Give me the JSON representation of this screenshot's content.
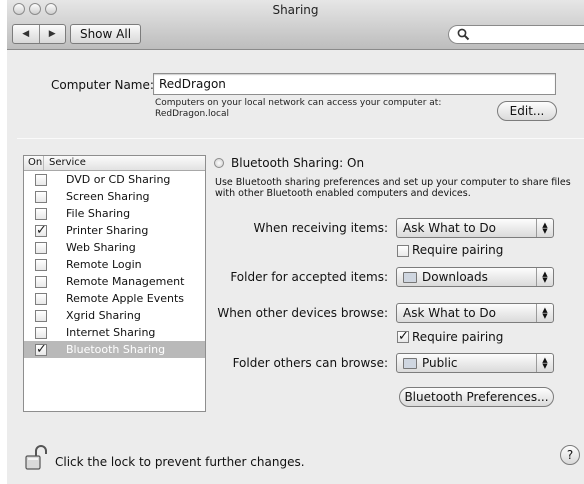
{
  "window": {
    "title": "Sharing"
  },
  "toolbar": {
    "back_icon": "◀",
    "forward_icon": "▶",
    "show_all_label": "Show All",
    "search_placeholder": ""
  },
  "computer_name": {
    "label": "Computer Name:",
    "value": "RedDragon",
    "description_line1": "Computers on your local network can access your computer at:",
    "description_line2": "RedDragon.local",
    "edit_label": "Edit..."
  },
  "services": {
    "header_on": "On",
    "header_service": "Service",
    "items": [
      {
        "name": "DVD or CD Sharing",
        "checked": false,
        "selected": false
      },
      {
        "name": "Screen Sharing",
        "checked": false,
        "selected": false
      },
      {
        "name": "File Sharing",
        "checked": false,
        "selected": false
      },
      {
        "name": "Printer Sharing",
        "checked": true,
        "selected": false
      },
      {
        "name": "Web Sharing",
        "checked": false,
        "selected": false
      },
      {
        "name": "Remote Login",
        "checked": false,
        "selected": false
      },
      {
        "name": "Remote Management",
        "checked": false,
        "selected": false
      },
      {
        "name": "Remote Apple Events",
        "checked": false,
        "selected": false
      },
      {
        "name": "Xgrid Sharing",
        "checked": false,
        "selected": false
      },
      {
        "name": "Internet Sharing",
        "checked": false,
        "selected": false
      },
      {
        "name": "Bluetooth Sharing",
        "checked": true,
        "selected": true
      }
    ]
  },
  "detail": {
    "status": "Bluetooth Sharing: On",
    "description_line1": "Use Bluetooth sharing preferences and set up your computer to share files",
    "description_line2": "with other Bluetooth enabled computers and devices.",
    "receiving_label": "When receiving items:",
    "receiving_value": "Ask What to Do",
    "require_pairing_1_label": "Require pairing",
    "require_pairing_1_checked": false,
    "accepted_folder_label": "Folder for accepted items:",
    "accepted_folder_value": "Downloads",
    "browse_label": "When other devices browse:",
    "browse_value": "Ask What to Do",
    "require_pairing_2_label": "Require pairing",
    "require_pairing_2_checked": true,
    "browse_folder_label": "Folder others can browse:",
    "browse_folder_value": "Public",
    "bt_prefs_label": "Bluetooth Preferences..."
  },
  "footer": {
    "lock_text": "Click the lock to prevent further changes.",
    "help_label": "?"
  }
}
